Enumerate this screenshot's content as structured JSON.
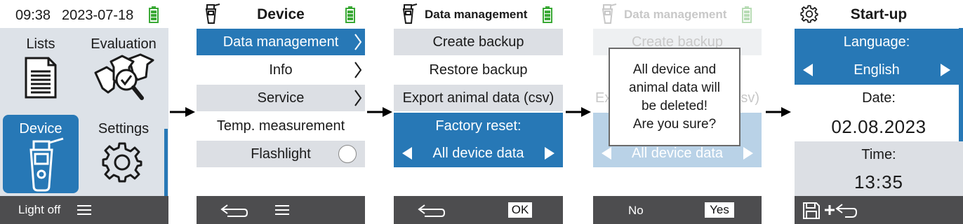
{
  "screen1": {
    "header": {
      "time": "09:38",
      "date": "2023-07-18"
    },
    "tiles": [
      {
        "label": "Lists",
        "icon": "list-document-icon"
      },
      {
        "label": "Evaluation",
        "icon": "cattle-check-icon"
      },
      {
        "label": "Device",
        "icon": "handheld-device-icon"
      },
      {
        "label": "Settings",
        "icon": "gear-icon"
      }
    ],
    "footer": {
      "left": "Light off",
      "menu_icon": "hamburger-icon"
    }
  },
  "screen2": {
    "title": "Device",
    "items": [
      "Data management",
      "Info",
      "Service",
      "Temp. measurement",
      "Flashlight"
    ],
    "footer_icons": [
      "back-icon",
      "hamburger-icon"
    ]
  },
  "screen3": {
    "title": "Data management",
    "items": [
      "Create backup",
      "Restore backup",
      "Export animal data (csv)"
    ],
    "factory_reset_label": "Factory reset:",
    "factory_reset_value": "All device data",
    "footer": {
      "ok": "OK"
    }
  },
  "screen4": {
    "title": "Data management",
    "bg_items": [
      "Create backup",
      "Ex",
      "sv)"
    ],
    "bg_value": "All device data",
    "dialog_lines": [
      "All device and",
      "animal data will",
      "be deleted!",
      "Are you sure?"
    ],
    "footer": {
      "no": "No",
      "yes": "Yes"
    }
  },
  "screen5": {
    "title": "Start-up",
    "language_label": "Language:",
    "language_value": "English",
    "date_label": "Date:",
    "date_value": "02.08.2023",
    "time_label": "Time:",
    "time_value": "13:35",
    "footer_icons": [
      "save-icon",
      "plus-icon",
      "back-icon"
    ]
  },
  "colors": {
    "accent_blue": "#2778b6",
    "light_blue": "#b9d2e7",
    "battery_green": "#3aa935",
    "footer_grey": "#4d4d4f",
    "row_grey": "#dcdfe4"
  }
}
